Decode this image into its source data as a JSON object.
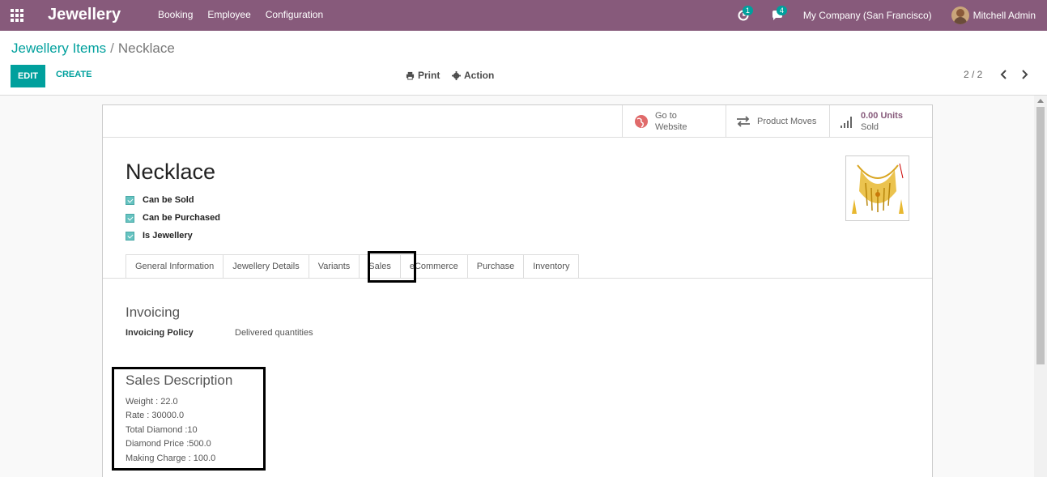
{
  "navbar": {
    "app_title": "Jewellery",
    "menu": [
      "Booking",
      "Employee",
      "Configuration"
    ],
    "activity_badge": "1",
    "messages_badge": "4",
    "company": "My Company (San Francisco)",
    "user": "Mitchell Admin"
  },
  "control": {
    "breadcrumb_parent": "Jewellery Items",
    "breadcrumb_sep": "/",
    "breadcrumb_current": "Necklace",
    "edit_label": "EDIT",
    "create_label": "CREATE",
    "print_label": "Print",
    "action_label": "Action",
    "pager": "2 / 2"
  },
  "stat_buttons": {
    "website_line1": "Go to",
    "website_line2": "Website",
    "moves_label": "Product Moves",
    "sold_value": "0.00 Units",
    "sold_label": "Sold"
  },
  "product": {
    "name": "Necklace",
    "checks": [
      "Can be Sold",
      "Can be Purchased",
      "Is Jewellery"
    ]
  },
  "tabs": [
    "General Information",
    "Jewellery Details",
    "Variants",
    "Sales",
    "eCommerce",
    "Purchase",
    "Inventory"
  ],
  "sales_tab": {
    "invoicing_title": "Invoicing",
    "invoicing_policy_label": "Invoicing Policy",
    "invoicing_policy_value": "Delivered quantities",
    "description_title": "Sales Description",
    "description_lines": [
      "Weight : 22.0",
      "Rate : 30000.0",
      "Total Diamond :10",
      "Diamond Price :500.0",
      "Making Charge : 100.0"
    ]
  },
  "colors": {
    "brand": "#875A7B",
    "accent": "#00A09D"
  }
}
